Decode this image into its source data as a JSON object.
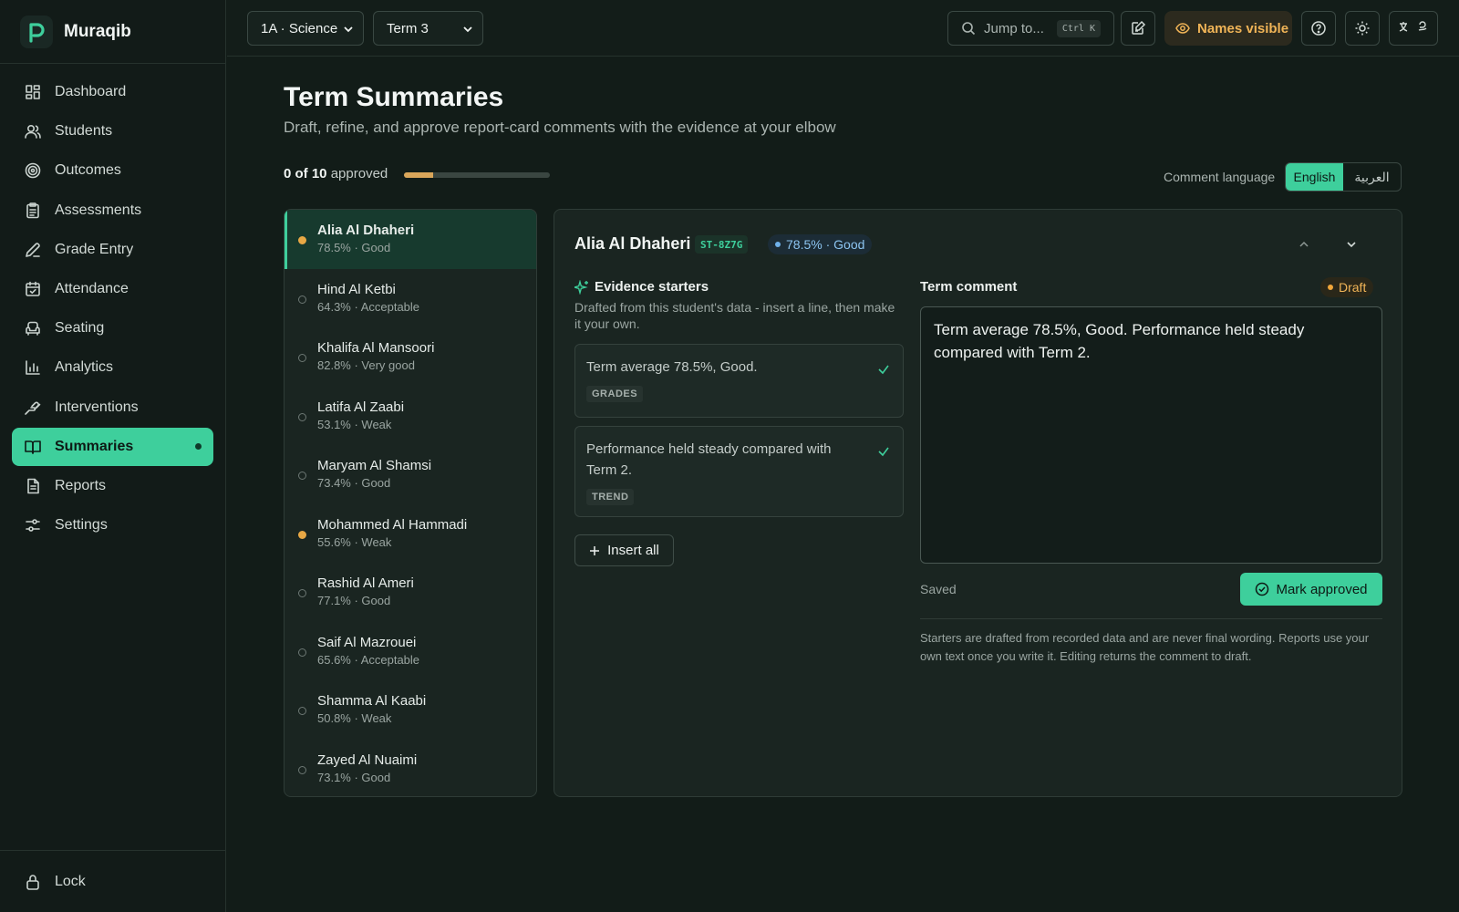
{
  "app": {
    "name": "Muraqib"
  },
  "colors": {
    "accent": "#3ecf9c",
    "warning": "#f0b457",
    "info": "#8cc4f0",
    "background": "#121c18"
  },
  "sidebar": {
    "items": [
      {
        "label": "Dashboard",
        "icon": "grid-icon"
      },
      {
        "label": "Students",
        "icon": "users-icon"
      },
      {
        "label": "Outcomes",
        "icon": "target-icon"
      },
      {
        "label": "Assessments",
        "icon": "clipboard-icon"
      },
      {
        "label": "Grade Entry",
        "icon": "pen-icon"
      },
      {
        "label": "Attendance",
        "icon": "calendar-check-icon"
      },
      {
        "label": "Seating",
        "icon": "armchair-icon"
      },
      {
        "label": "Analytics",
        "icon": "bar-chart-icon"
      },
      {
        "label": "Interventions",
        "icon": "hand-heart-icon"
      },
      {
        "label": "Summaries",
        "icon": "book-icon",
        "active": true
      },
      {
        "label": "Reports",
        "icon": "file-text-icon"
      },
      {
        "label": "Settings",
        "icon": "sliders-icon"
      }
    ],
    "footer": {
      "label": "Lock",
      "icon": "lock-icon"
    }
  },
  "topbar": {
    "class_select": "1A · Science",
    "term_select": "Term 3",
    "search": {
      "placeholder": "Jump to...",
      "shortcut": "Ctrl K"
    },
    "names_toggle": "Names visible"
  },
  "page": {
    "title": "Term Summaries",
    "subtitle": "Draft, refine, and approve report-card comments with the evidence at your elbow",
    "progress": {
      "count_text": "0 of 10",
      "suffix": "approved",
      "fraction": 0.2
    },
    "comment_language": {
      "label": "Comment language",
      "options": [
        "English",
        "العربية"
      ],
      "selected": "English"
    }
  },
  "students": [
    {
      "name": "Alia Al Dhaheri",
      "meta": "78.5% · Good",
      "flag": true,
      "active": true
    },
    {
      "name": "Hind Al Ketbi",
      "meta": "64.3% · Acceptable",
      "flag": false
    },
    {
      "name": "Khalifa Al Mansoori",
      "meta": "82.8% · Very good",
      "flag": false
    },
    {
      "name": "Latifa Al Zaabi",
      "meta": "53.1% · Weak",
      "flag": false
    },
    {
      "name": "Maryam Al Shamsi",
      "meta": "73.4% · Good",
      "flag": false
    },
    {
      "name": "Mohammed Al Hammadi",
      "meta": "55.6% · Weak",
      "flag": true
    },
    {
      "name": "Rashid Al Ameri",
      "meta": "77.1% · Good",
      "flag": false
    },
    {
      "name": "Saif Al Mazrouei",
      "meta": "65.6% · Acceptable",
      "flag": false
    },
    {
      "name": "Shamma Al Kaabi",
      "meta": "50.8% · Weak",
      "flag": false
    },
    {
      "name": "Zayed Al Nuaimi",
      "meta": "73.1% · Good",
      "flag": false
    }
  ],
  "detail": {
    "name": "Alia Al Dhaheri",
    "id": "ST-8Z7G",
    "grade": "78.5% · Good",
    "evidence": {
      "title": "Evidence starters",
      "subtitle": "Drafted from this student's data - insert a line, then make it your own.",
      "cards": [
        {
          "text": "Term average 78.5%, Good.",
          "tag": "GRADES"
        },
        {
          "text": "Performance held steady compared with Term 2.",
          "tag": "TREND"
        }
      ],
      "insert_all": "Insert all"
    },
    "comment": {
      "title": "Term comment",
      "status": "Draft",
      "text": "Term average 78.5%, Good. Performance held steady compared with Term 2.",
      "saved": "Saved",
      "approve": "Mark approved",
      "note": "Starters are drafted from recorded data and are never final wording. Reports use your own text once you write it. Editing returns the comment to draft."
    }
  }
}
